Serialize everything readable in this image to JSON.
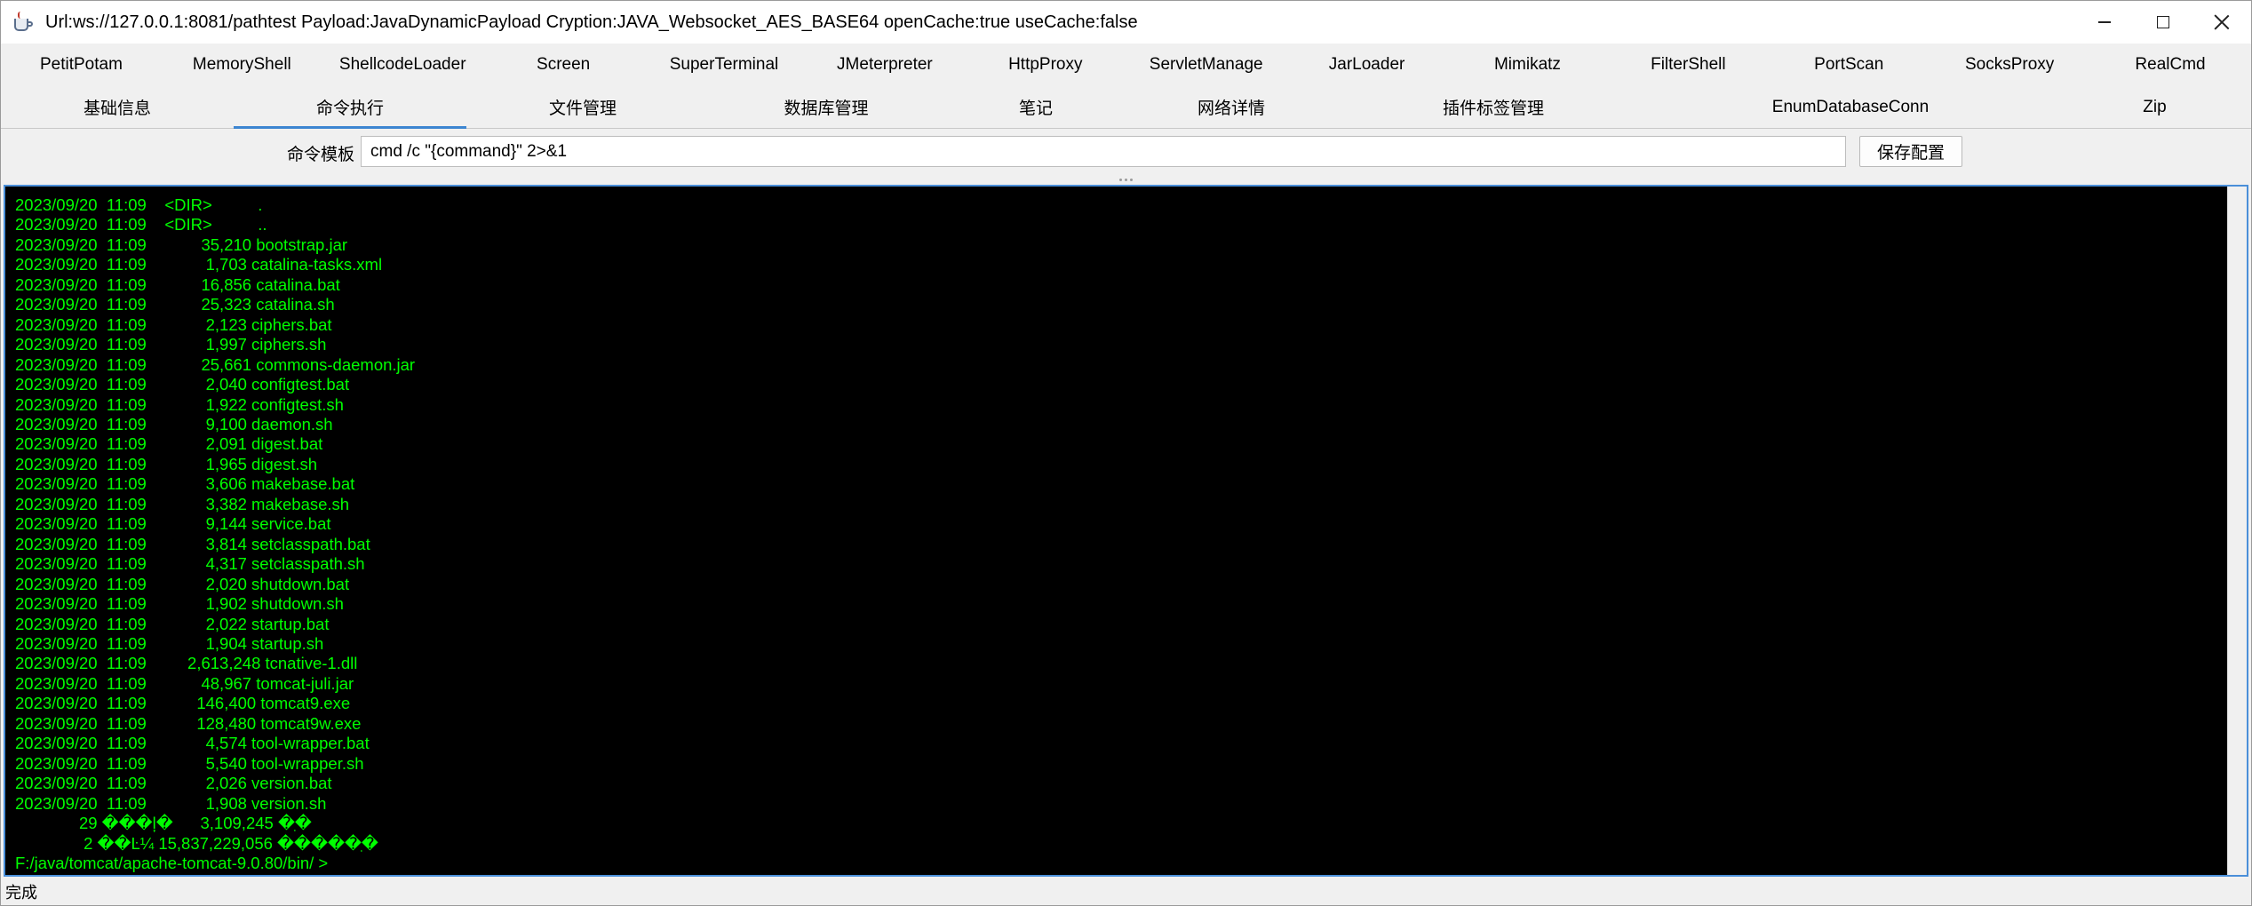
{
  "window": {
    "title": "Url:ws://127.0.0.1:8081/pathtest Payload:JavaDynamicPayload Cryption:JAVA_Websocket_AES_BASE64 openCache:true useCache:false",
    "icon": "java-cup-icon"
  },
  "plugin_tabs": [
    "PetitPotam",
    "MemoryShell",
    "ShellcodeLoader",
    "Screen",
    "SuperTerminal",
    "JMeterpreter",
    "HttpProxy",
    "ServletManage",
    "JarLoader",
    "Mimikatz",
    "FilterShell",
    "PortScan",
    "SocksProxy",
    "RealCmd"
  ],
  "main_tabs": [
    "基础信息",
    "命令执行",
    "文件管理",
    "数据库管理",
    "笔记",
    "网络详情",
    "插件标签管理",
    "EnumDatabaseConn",
    "Zip"
  ],
  "active_main_tab": "命令执行",
  "command_template": {
    "label": "命令模板",
    "value": "cmd /c \"{command}\" 2>&1",
    "save_button": "保存配置"
  },
  "console": {
    "lines": [
      "2023/09/20  11:09    <DIR>          .",
      "2023/09/20  11:09    <DIR>          ..",
      "2023/09/20  11:09            35,210 bootstrap.jar",
      "2023/09/20  11:09             1,703 catalina-tasks.xml",
      "2023/09/20  11:09            16,856 catalina.bat",
      "2023/09/20  11:09            25,323 catalina.sh",
      "2023/09/20  11:09             2,123 ciphers.bat",
      "2023/09/20  11:09             1,997 ciphers.sh",
      "2023/09/20  11:09            25,661 commons-daemon.jar",
      "2023/09/20  11:09             2,040 configtest.bat",
      "2023/09/20  11:09             1,922 configtest.sh",
      "2023/09/20  11:09             9,100 daemon.sh",
      "2023/09/20  11:09             2,091 digest.bat",
      "2023/09/20  11:09             1,965 digest.sh",
      "2023/09/20  11:09             3,606 makebase.bat",
      "2023/09/20  11:09             3,382 makebase.sh",
      "2023/09/20  11:09             9,144 service.bat",
      "2023/09/20  11:09             3,814 setclasspath.bat",
      "2023/09/20  11:09             4,317 setclasspath.sh",
      "2023/09/20  11:09             2,020 shutdown.bat",
      "2023/09/20  11:09             1,902 shutdown.sh",
      "2023/09/20  11:09             2,022 startup.bat",
      "2023/09/20  11:09             1,904 startup.sh",
      "2023/09/20  11:09         2,613,248 tcnative-1.dll",
      "2023/09/20  11:09            48,967 tomcat-juli.jar",
      "2023/09/20  11:09           146,400 tomcat9.exe",
      "2023/09/20  11:09           128,480 tomcat9w.exe",
      "2023/09/20  11:09             4,574 tool-wrapper.bat",
      "2023/09/20  11:09             5,540 tool-wrapper.sh",
      "2023/09/20  11:09             2,026 version.bat",
      "2023/09/20  11:09             1,908 version.sh",
      "              29 ���ļ�      3,109,245 �ֽ�",
      "               2 ��Ŀ¼ 15,837,229,056 �����ֽ�",
      "F:/java/tomcat/apache-tomcat-9.0.80/bin/ >"
    ]
  },
  "status": {
    "text": "完成"
  },
  "colors": {
    "console_bg": "#000000",
    "console_fg": "#00ff00",
    "accent": "#3d86d1"
  }
}
